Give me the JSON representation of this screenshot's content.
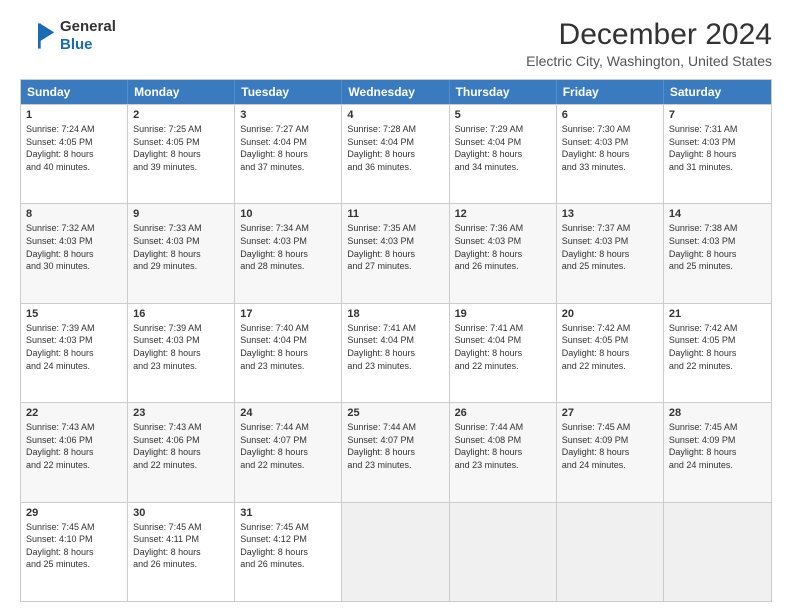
{
  "logo": {
    "line1": "General",
    "line2": "Blue"
  },
  "title": "December 2024",
  "subtitle": "Electric City, Washington, United States",
  "header_days": [
    "Sunday",
    "Monday",
    "Tuesday",
    "Wednesday",
    "Thursday",
    "Friday",
    "Saturday"
  ],
  "rows": [
    [
      {
        "day": "1",
        "text": "Sunrise: 7:24 AM\nSunset: 4:05 PM\nDaylight: 8 hours\nand 40 minutes."
      },
      {
        "day": "2",
        "text": "Sunrise: 7:25 AM\nSunset: 4:05 PM\nDaylight: 8 hours\nand 39 minutes."
      },
      {
        "day": "3",
        "text": "Sunrise: 7:27 AM\nSunset: 4:04 PM\nDaylight: 8 hours\nand 37 minutes."
      },
      {
        "day": "4",
        "text": "Sunrise: 7:28 AM\nSunset: 4:04 PM\nDaylight: 8 hours\nand 36 minutes."
      },
      {
        "day": "5",
        "text": "Sunrise: 7:29 AM\nSunset: 4:04 PM\nDaylight: 8 hours\nand 34 minutes."
      },
      {
        "day": "6",
        "text": "Sunrise: 7:30 AM\nSunset: 4:03 PM\nDaylight: 8 hours\nand 33 minutes."
      },
      {
        "day": "7",
        "text": "Sunrise: 7:31 AM\nSunset: 4:03 PM\nDaylight: 8 hours\nand 31 minutes."
      }
    ],
    [
      {
        "day": "8",
        "text": "Sunrise: 7:32 AM\nSunset: 4:03 PM\nDaylight: 8 hours\nand 30 minutes."
      },
      {
        "day": "9",
        "text": "Sunrise: 7:33 AM\nSunset: 4:03 PM\nDaylight: 8 hours\nand 29 minutes."
      },
      {
        "day": "10",
        "text": "Sunrise: 7:34 AM\nSunset: 4:03 PM\nDaylight: 8 hours\nand 28 minutes."
      },
      {
        "day": "11",
        "text": "Sunrise: 7:35 AM\nSunset: 4:03 PM\nDaylight: 8 hours\nand 27 minutes."
      },
      {
        "day": "12",
        "text": "Sunrise: 7:36 AM\nSunset: 4:03 PM\nDaylight: 8 hours\nand 26 minutes."
      },
      {
        "day": "13",
        "text": "Sunrise: 7:37 AM\nSunset: 4:03 PM\nDaylight: 8 hours\nand 25 minutes."
      },
      {
        "day": "14",
        "text": "Sunrise: 7:38 AM\nSunset: 4:03 PM\nDaylight: 8 hours\nand 25 minutes."
      }
    ],
    [
      {
        "day": "15",
        "text": "Sunrise: 7:39 AM\nSunset: 4:03 PM\nDaylight: 8 hours\nand 24 minutes."
      },
      {
        "day": "16",
        "text": "Sunrise: 7:39 AM\nSunset: 4:03 PM\nDaylight: 8 hours\nand 23 minutes."
      },
      {
        "day": "17",
        "text": "Sunrise: 7:40 AM\nSunset: 4:04 PM\nDaylight: 8 hours\nand 23 minutes."
      },
      {
        "day": "18",
        "text": "Sunrise: 7:41 AM\nSunset: 4:04 PM\nDaylight: 8 hours\nand 23 minutes."
      },
      {
        "day": "19",
        "text": "Sunrise: 7:41 AM\nSunset: 4:04 PM\nDaylight: 8 hours\nand 22 minutes."
      },
      {
        "day": "20",
        "text": "Sunrise: 7:42 AM\nSunset: 4:05 PM\nDaylight: 8 hours\nand 22 minutes."
      },
      {
        "day": "21",
        "text": "Sunrise: 7:42 AM\nSunset: 4:05 PM\nDaylight: 8 hours\nand 22 minutes."
      }
    ],
    [
      {
        "day": "22",
        "text": "Sunrise: 7:43 AM\nSunset: 4:06 PM\nDaylight: 8 hours\nand 22 minutes."
      },
      {
        "day": "23",
        "text": "Sunrise: 7:43 AM\nSunset: 4:06 PM\nDaylight: 8 hours\nand 22 minutes."
      },
      {
        "day": "24",
        "text": "Sunrise: 7:44 AM\nSunset: 4:07 PM\nDaylight: 8 hours\nand 22 minutes."
      },
      {
        "day": "25",
        "text": "Sunrise: 7:44 AM\nSunset: 4:07 PM\nDaylight: 8 hours\nand 23 minutes."
      },
      {
        "day": "26",
        "text": "Sunrise: 7:44 AM\nSunset: 4:08 PM\nDaylight: 8 hours\nand 23 minutes."
      },
      {
        "day": "27",
        "text": "Sunrise: 7:45 AM\nSunset: 4:09 PM\nDaylight: 8 hours\nand 24 minutes."
      },
      {
        "day": "28",
        "text": "Sunrise: 7:45 AM\nSunset: 4:09 PM\nDaylight: 8 hours\nand 24 minutes."
      }
    ],
    [
      {
        "day": "29",
        "text": "Sunrise: 7:45 AM\nSunset: 4:10 PM\nDaylight: 8 hours\nand 25 minutes."
      },
      {
        "day": "30",
        "text": "Sunrise: 7:45 AM\nSunset: 4:11 PM\nDaylight: 8 hours\nand 26 minutes."
      },
      {
        "day": "31",
        "text": "Sunrise: 7:45 AM\nSunset: 4:12 PM\nDaylight: 8 hours\nand 26 minutes."
      },
      {
        "day": "",
        "text": ""
      },
      {
        "day": "",
        "text": ""
      },
      {
        "day": "",
        "text": ""
      },
      {
        "day": "",
        "text": ""
      }
    ]
  ]
}
